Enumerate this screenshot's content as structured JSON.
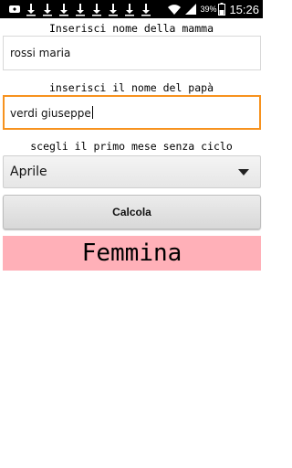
{
  "status_bar": {
    "icons": [
      "usb-icon",
      "download-icon",
      "download-icon",
      "download-icon",
      "download-icon",
      "download-icon",
      "download-icon",
      "download-icon",
      "download-icon",
      "wifi-icon",
      "signal-icon",
      "battery-icon"
    ],
    "battery_percent": "39%",
    "time": "15:26"
  },
  "form": {
    "mother_label": "Inserisci nome della mamma",
    "mother_value": "rossi maria",
    "father_label": "inserisci il nome del papà",
    "father_value": "verdi giuseppe",
    "month_label": "scegli il primo mese senza ciclo",
    "month_selected": "Aprile",
    "calculate_label": "Calcola"
  },
  "result": {
    "text": "Femmina",
    "background_color": "#ffb0b8"
  },
  "colors": {
    "focus_accent": "#f7921e"
  }
}
